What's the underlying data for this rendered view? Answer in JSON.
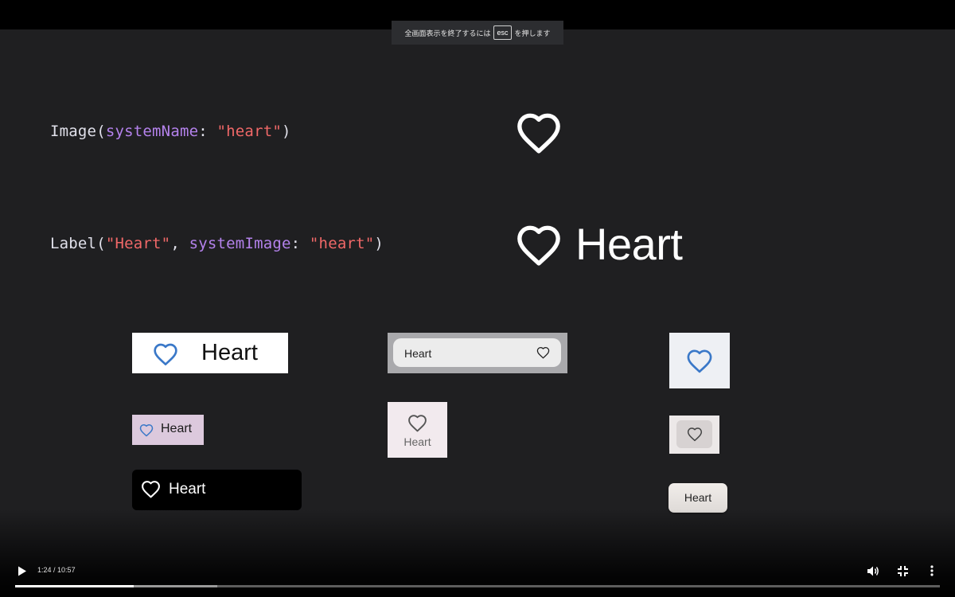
{
  "banner": {
    "prefix": "全画面表示を終了するには",
    "key": "esc",
    "suffix": "を押します"
  },
  "code_lines": {
    "image": {
      "fn": "Image",
      "open": "(",
      "param": "systemName",
      "colon": ": ",
      "value": "\"heart\"",
      "close": ")"
    },
    "label": {
      "fn": "Label",
      "open": "(",
      "title": "\"Heart\"",
      "comma": ", ",
      "param": "systemImage",
      "colon": ": ",
      "value": "\"heart\"",
      "close": ")"
    }
  },
  "rendered_label": "Heart",
  "examples": {
    "row1_left": "Heart",
    "row2_left": "Heart",
    "row3_left": "Heart",
    "row1_mid": "Heart",
    "row2_mid": "Heart",
    "row3_right": "Heart"
  },
  "player": {
    "current_time": "1:24",
    "separator": " / ",
    "duration": "10:57",
    "played_fraction": 0.128,
    "buffered_fraction": 0.219
  },
  "icons": {
    "play": "play-icon",
    "volume": "volume-icon",
    "exit_fullscreen": "exit-fullscreen-icon",
    "more": "more-vertical-icon"
  },
  "colors": {
    "param": "#b482ec",
    "string": "#f06868",
    "heart_blue": "#3a78c8"
  }
}
